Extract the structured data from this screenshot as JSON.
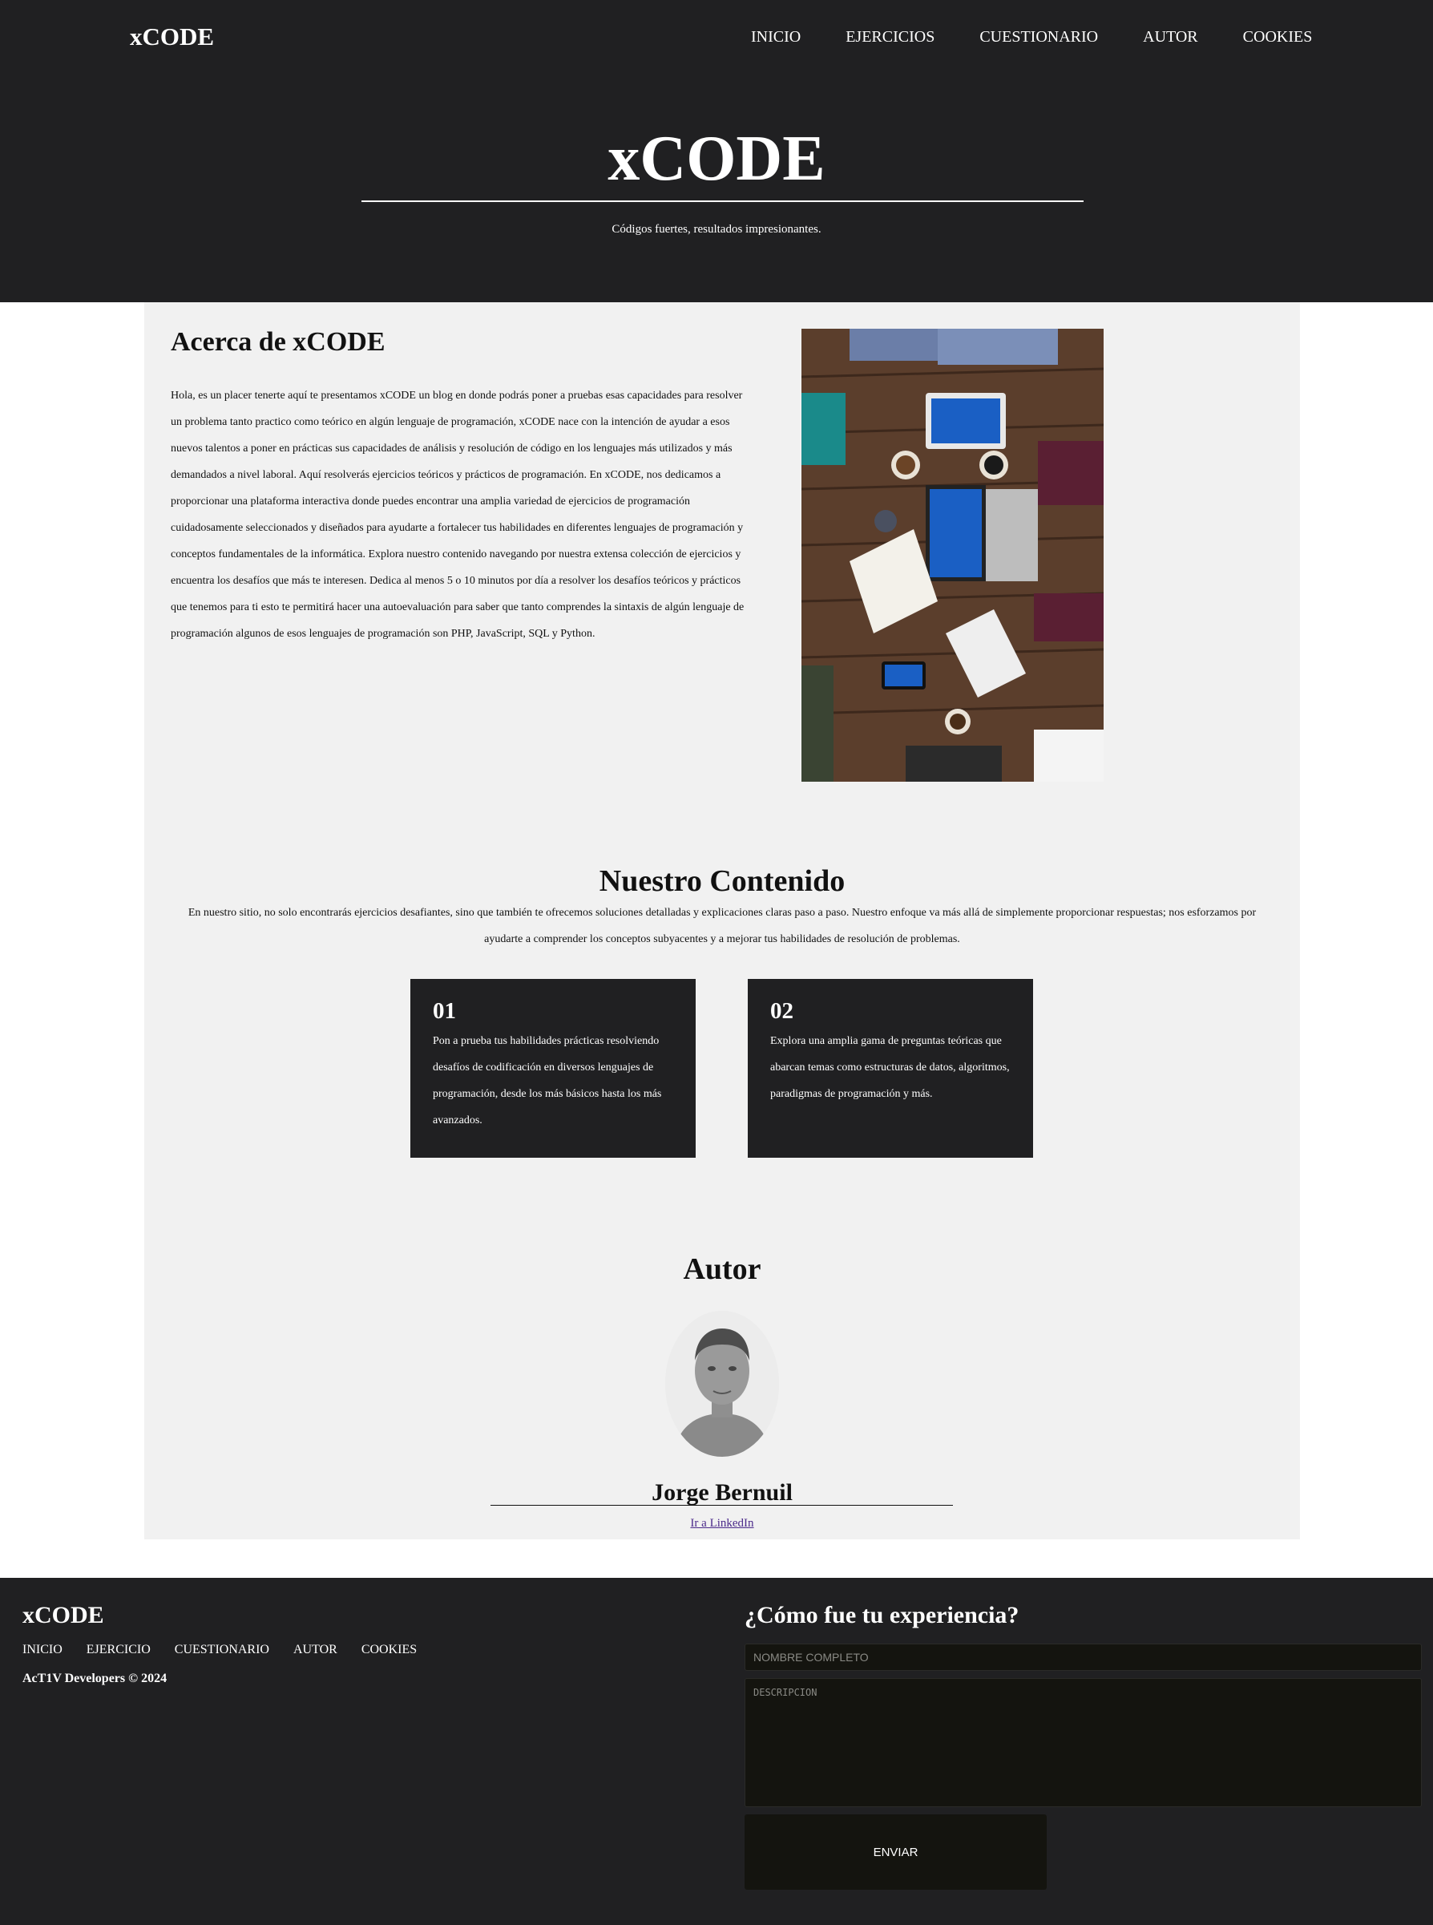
{
  "header": {
    "brand": "xCODE",
    "nav": [
      "INICIO",
      "EJERCICIOS",
      "CUESTIONARIO",
      "AUTOR",
      "COOKIES"
    ],
    "hero_title": "xCODE",
    "hero_subtitle": "Códigos fuertes, resultados impresionantes."
  },
  "about": {
    "title": "Acerca de xCODE",
    "text": "Hola, es un placer tenerte aquí te presentamos xCODE un blog en donde podrás poner a pruebas esas capacidades para resolver un problema tanto practico como teórico en algún lenguaje de programación, xCODE nace con la intención de ayudar a esos nuevos talentos a poner en prácticas sus capacidades de análisis y resolución de código en los lenguajes más utilizados y más demandados a nivel laboral. Aquí resolverás ejercicios teóricos y prácticos de programación. En xCODE, nos dedicamos a proporcionar una plataforma interactiva donde puedes encontrar una amplia variedad de ejercicios de programación cuidadosamente seleccionados y diseñados para ayudarte a fortalecer tus habilidades en diferentes lenguajes de programación y conceptos fundamentales de la informática. Explora nuestro contenido navegando por nuestra extensa colección de ejercicios y encuentra los desafíos que más te interesen. Dedica al menos 5 o 10 minutos por día a resolver los desafíos teóricos y prácticos que tenemos para ti esto te permitirá hacer una autoevaluación para saber que tanto comprendes la sintaxis de algún lenguaje de programación algunos de esos lenguajes de programación son PHP, JavaScript, SQL y Python."
  },
  "content": {
    "title": "Nuestro Contenido",
    "text": "En nuestro sitio, no solo encontrarás ejercicios desafiantes, sino que también te ofrecemos soluciones detalladas y explicaciones claras paso a paso. Nuestro enfoque va más allá de simplemente proporcionar respuestas; nos esforzamos por ayudarte a comprender los conceptos subyacentes y a mejorar tus habilidades de resolución de problemas.",
    "cards": [
      {
        "num": "01",
        "text": "Pon a prueba tus habilidades prácticas resolviendo desafíos de codificación en diversos lenguajes de programación, desde los más básicos hasta los más avanzados."
      },
      {
        "num": "02",
        "text": "Explora una amplia gama de preguntas teóricas que abarcan temas como estructuras de datos, algoritmos, paradigmas de programación y más."
      }
    ]
  },
  "author": {
    "title": "Autor",
    "name": "Jorge Bernuil",
    "link": "Ir a LinkedIn"
  },
  "footer": {
    "brand": "xCODE",
    "nav": [
      "INICIO",
      "EJERCICIO",
      "CUESTIONARIO",
      "AUTOR",
      "COOKIES"
    ],
    "copyright": "AcT1V Developers © 2024",
    "form_title": "¿Cómo fue tu experiencia?",
    "name_placeholder": "NOMBRE COMPLETO",
    "desc_placeholder": "DESCRIPCION",
    "submit_label": "ENVIAR"
  }
}
